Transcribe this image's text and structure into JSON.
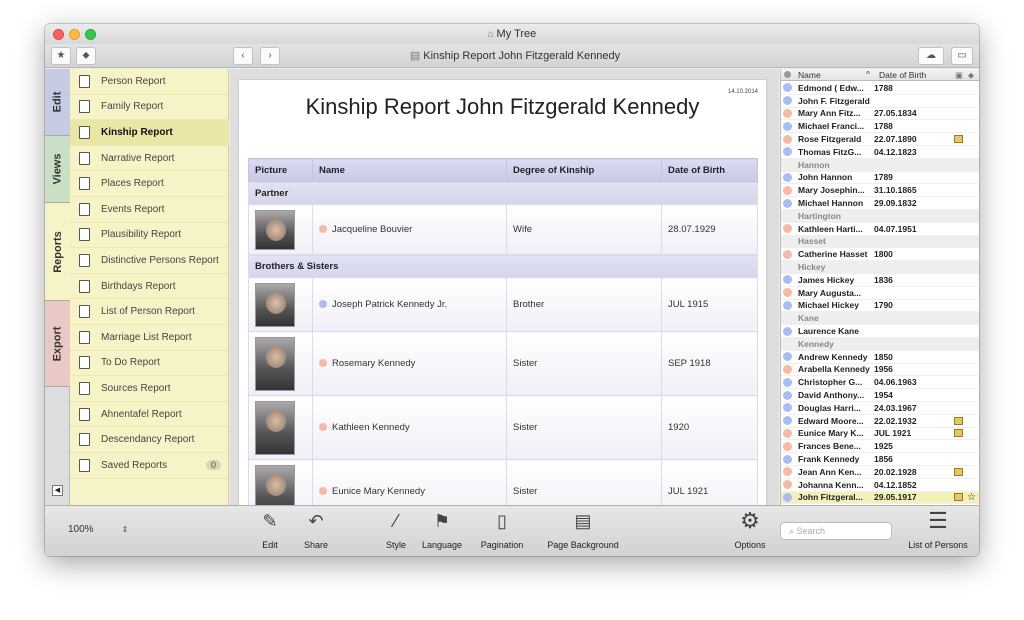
{
  "window": {
    "title": "My Tree",
    "doc_title": "Kinship Report John Fitzgerald Kennedy"
  },
  "side_tabs": [
    "Edit",
    "Views",
    "Reports",
    "Export"
  ],
  "reports": [
    {
      "label": "Person Report",
      "icon": "person-card-icon"
    },
    {
      "label": "Family Report",
      "icon": "family-icon"
    },
    {
      "label": "Kinship Report",
      "icon": "kinship-icon",
      "selected": true
    },
    {
      "label": "Narrative Report",
      "icon": "narrative-icon"
    },
    {
      "label": "Places Report",
      "icon": "pin-icon"
    },
    {
      "label": "Events Report",
      "icon": "events-icon"
    },
    {
      "label": "Plausibility Report",
      "icon": "magnifier-icon"
    },
    {
      "label": "Distinctive Persons Report",
      "icon": "exclamation-icon"
    },
    {
      "label": "Birthdays Report",
      "icon": "star-icon"
    },
    {
      "label": "List of Person Report",
      "icon": "list-icon"
    },
    {
      "label": "Marriage List Report",
      "icon": "rings-icon"
    },
    {
      "label": "To Do Report",
      "icon": "checkbox-icon"
    },
    {
      "label": "Sources Report",
      "icon": "sources-icon"
    },
    {
      "label": "Ahnentafel Report",
      "icon": "ahnentafel-icon"
    },
    {
      "label": "Descendancy Report",
      "icon": "descendancy-icon"
    },
    {
      "label": "Saved Reports",
      "icon": "saved-reports-icon",
      "badge": "0"
    }
  ],
  "report": {
    "title": "Kinship Report John Fitzgerald Kennedy",
    "date": "14.10.2014",
    "columns": [
      "Picture",
      "Name",
      "Degree of Kinship",
      "Date of Birth"
    ],
    "groups": [
      {
        "name": "Partner",
        "rows": [
          {
            "name": "Jacqueline Bouvier",
            "kin": "Wife",
            "birth": "28.07.1929",
            "sex": "f"
          }
        ]
      },
      {
        "name": "Brothers & Sisters",
        "rows": [
          {
            "name": "Joseph Patrick Kennedy Jr.",
            "kin": "Brother",
            "birth": "JUL 1915",
            "sex": "m"
          },
          {
            "name": "Rosemary Kennedy",
            "kin": "Sister",
            "birth": "SEP 1918",
            "sex": "f"
          },
          {
            "name": "Kathleen Kennedy",
            "kin": "Sister",
            "birth": "1920",
            "sex": "f"
          },
          {
            "name": "Eunice Mary Kennedy",
            "kin": "Sister",
            "birth": "JUL 1921",
            "sex": "f"
          }
        ]
      }
    ]
  },
  "persons_list": {
    "headers": {
      "name": "Name",
      "birth": "Date of Birth"
    },
    "rows": [
      {
        "name": "Edmond ( Edw...",
        "birth": "1788",
        "sex": "m"
      },
      {
        "name": "John F. Fitzgerald",
        "birth": "",
        "sex": "m"
      },
      {
        "name": "Mary Ann Fitz...",
        "birth": "27.05.1834",
        "sex": "f"
      },
      {
        "name": "Michael Franci...",
        "birth": "1788",
        "sex": "m"
      },
      {
        "name": "Rose Fitzgerald",
        "birth": "22.07.1890",
        "sex": "f",
        "img": true
      },
      {
        "name": "Thomas FitzG...",
        "birth": "04.12.1823",
        "sex": "m"
      },
      {
        "section": "Hannon"
      },
      {
        "name": "John Hannon",
        "birth": "1789",
        "sex": "m"
      },
      {
        "name": "Mary Josephin...",
        "birth": "31.10.1865",
        "sex": "f"
      },
      {
        "name": "Michael Hannon",
        "birth": "29.09.1832",
        "sex": "m"
      },
      {
        "section": "Hartington"
      },
      {
        "name": "Kathleen Harti...",
        "birth": "04.07.1951",
        "sex": "f"
      },
      {
        "section": "Hasset"
      },
      {
        "name": "Catherine Hasset",
        "birth": "1800",
        "sex": "f"
      },
      {
        "section": "Hickey"
      },
      {
        "name": "James Hickey",
        "birth": "1836",
        "sex": "m"
      },
      {
        "name": "Mary Augusta...",
        "birth": "",
        "sex": "f"
      },
      {
        "name": "Michael Hickey",
        "birth": "1790",
        "sex": "m"
      },
      {
        "section": "Kane"
      },
      {
        "name": "Laurence Kane",
        "birth": "",
        "sex": "m"
      },
      {
        "section": "Kennedy"
      },
      {
        "name": "Andrew Kennedy",
        "birth": "1850",
        "sex": "m"
      },
      {
        "name": "Arabella Kennedy",
        "birth": "1956",
        "sex": "f"
      },
      {
        "name": "Christopher G...",
        "birth": "04.06.1963",
        "sex": "m"
      },
      {
        "name": "David Anthony...",
        "birth": "1954",
        "sex": "m"
      },
      {
        "name": "Douglas Harri...",
        "birth": "24.03.1967",
        "sex": "m"
      },
      {
        "name": "Edward Moore...",
        "birth": "22.02.1932",
        "sex": "m",
        "img": true
      },
      {
        "name": "Eunice Mary K...",
        "birth": "JUL 1921",
        "sex": "f",
        "img": true
      },
      {
        "name": "Frances Bene...",
        "birth": "1925",
        "sex": "f"
      },
      {
        "name": "Frank Kennedy",
        "birth": "1856",
        "sex": "m"
      },
      {
        "name": "Jean Ann Ken...",
        "birth": "20.02.1928",
        "sex": "f",
        "img": true
      },
      {
        "name": "Johanna Kenn...",
        "birth": "04.12.1852",
        "sex": "f"
      },
      {
        "name": "John Fitzgeral...",
        "birth": "29.05.1917",
        "sex": "m",
        "img": true,
        "selected": true
      }
    ]
  },
  "bottom": {
    "zoom": "100%",
    "tools": [
      {
        "label": "Edit",
        "icon": "pencil-icon",
        "glyph": "✎"
      },
      {
        "label": "Share",
        "icon": "share-arrow-icon",
        "glyph": "↶"
      },
      {
        "label": "Style",
        "icon": "magic-wand-icon",
        "glyph": "⁄"
      },
      {
        "label": "Language",
        "icon": "un-flag-icon",
        "glyph": "⚑"
      },
      {
        "label": "Pagination",
        "icon": "page-icon",
        "glyph": "▯"
      },
      {
        "label": "Page Background",
        "icon": "page-background-icon",
        "glyph": "▤"
      }
    ],
    "options": "Options",
    "search_placeholder": "Search",
    "list_of_persons": "List of Persons"
  },
  "colors": {
    "male": "#a9bdf5",
    "female": "#f6b9a3",
    "report_sidebar": "#f6f4c7"
  }
}
